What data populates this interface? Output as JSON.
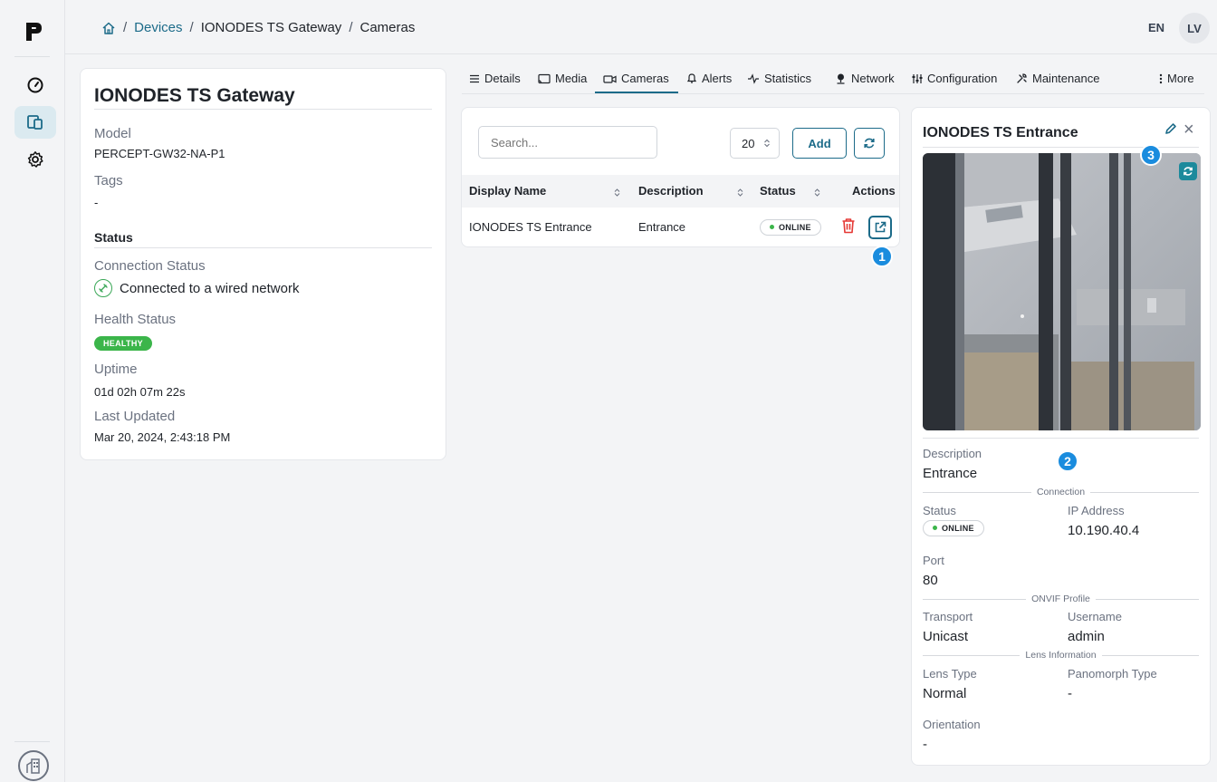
{
  "breadcrumb": {
    "items": [
      "Devices",
      "IONODES TS Gateway",
      "Cameras"
    ],
    "separator": "/"
  },
  "header": {
    "language": "EN",
    "avatar_initials": "LV"
  },
  "device": {
    "title": "IONODES TS Gateway",
    "model_label": "Model",
    "model_value": "PERCEPT-GW32-NA-P1",
    "tags_label": "Tags",
    "tags_value": "-",
    "status_heading": "Status",
    "connection_label": "Connection Status",
    "connection_value": "Connected to a wired network",
    "health_label": "Health Status",
    "health_value": "HEALTHY",
    "uptime_label": "Uptime",
    "uptime_value": "01d 02h 07m 22s",
    "updated_label": "Last Updated",
    "updated_value": "Mar 20, 2024, 2:43:18 PM"
  },
  "tabs": {
    "details": "Details",
    "media": "Media",
    "cameras": "Cameras",
    "alerts": "Alerts",
    "statistics": "Statistics",
    "network": "Network",
    "configuration": "Configuration",
    "maintenance": "Maintenance",
    "more": "More",
    "active": "Cameras"
  },
  "cameras": {
    "search_placeholder": "Search...",
    "page_size": "20",
    "add_label": "Add",
    "columns": {
      "display_name": "Display Name",
      "description": "Description",
      "status": "Status",
      "actions": "Actions"
    },
    "rows": [
      {
        "display_name": "IONODES TS Entrance",
        "description": "Entrance",
        "status": "ONLINE"
      }
    ]
  },
  "markers": {
    "one": "1",
    "two": "2",
    "three": "3"
  },
  "camera_detail": {
    "title": "IONODES TS Entrance",
    "description_label": "Description",
    "description_value": "Entrance",
    "section_connection": "Connection",
    "status_label": "Status",
    "status_value": "ONLINE",
    "ip_label": "IP Address",
    "ip_value": "10.190.40.4",
    "port_label": "Port",
    "port_value": "80",
    "section_onvif": "ONVIF Profile",
    "transport_label": "Transport",
    "transport_value": "Unicast",
    "username_label": "Username",
    "username_value": "admin",
    "section_lens": "Lens Information",
    "lens_type_label": "Lens Type",
    "lens_type_value": "Normal",
    "panomorph_label": "Panomorph Type",
    "panomorph_value": "-",
    "orientation_label": "Orientation",
    "orientation_value": "-"
  },
  "colors": {
    "accent": "#1c6b89",
    "online": "#3bb54a",
    "marker": "#1a8cde",
    "delete": "#e53935"
  },
  "icons": {
    "rail": [
      "dashboard-icon",
      "devices-icon",
      "settings-icon",
      "building-icon"
    ],
    "tabs": [
      "list-icon",
      "media-icon",
      "camera-icon",
      "bell-icon",
      "pulse-icon",
      "network-icon",
      "sliders-icon",
      "wrench-icon",
      "dots-vertical-icon"
    ]
  }
}
